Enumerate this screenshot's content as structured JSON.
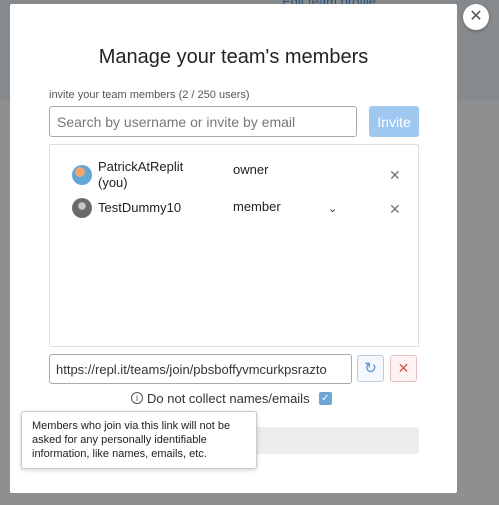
{
  "backdrop": {
    "link_text": "Edit team profile"
  },
  "modal": {
    "title": "Manage your team's members",
    "invite_label": "invite your team members (2 / 250 users)",
    "search_placeholder": "Search by username or invite by email",
    "invite_button": "Invite",
    "close_icon": "close-icon"
  },
  "members": [
    {
      "name": "PatrickAtReplit (you)",
      "role": "owner",
      "has_role_dropdown": false,
      "avatar_icon": "avatar-icon"
    },
    {
      "name": "TestDummy10",
      "role": "member",
      "has_role_dropdown": true,
      "avatar_icon": "avatar-icon"
    }
  ],
  "invite_link": {
    "value": "https://repl.it/teams/join/pbsboffyvmcurkpsrazto",
    "refresh_icon": "refresh-icon",
    "revoke_icon": "close-icon"
  },
  "collect": {
    "label": "Do not collect names/emails",
    "checked": true,
    "info_icon": "info-icon"
  },
  "tooltip": {
    "text": "Members who join via this link will not be asked for any personally identifiable information, like names, emails, etc."
  },
  "colors": {
    "accent": "#4a90d9",
    "invite_button_bg": "#9fc8f0",
    "danger": "#d9534f",
    "overlay": "rgba(0,0,0,0.42)"
  }
}
